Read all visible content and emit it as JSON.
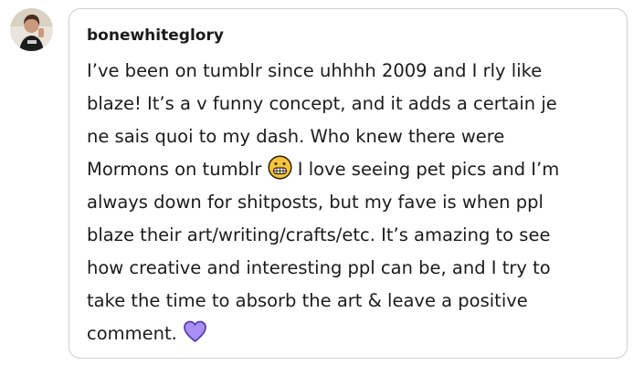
{
  "post": {
    "username": "bonewhiteglory",
    "lines": [
      "I’ve been on tumblr since uhhhh 2009 and I rly like",
      "blaze! It’s a v funny concept, and it adds a certain je",
      "ne sais quoi to my dash. Who knew there were",
      "Mormons on tumblr",
      " I love seeing pet pics and I’m",
      "always down for shitposts, but my fave is when ppl",
      "blaze their art/writing/crafts/etc. It’s amazing to see",
      "how creative and interesting ppl can be, and I try to",
      "take the time to absorb the art & leave a positive",
      "comment."
    ]
  },
  "icons": {
    "emoji_grimace": "grimacing-face-icon",
    "emoji_heart": "purple-heart-icon"
  },
  "colors": {
    "text": "#1b1b1b",
    "border": "#cfcfcf",
    "heart": "#a98ef5",
    "heart_outline": "#5b3fb0",
    "emoji_face": "#f7c53b"
  }
}
